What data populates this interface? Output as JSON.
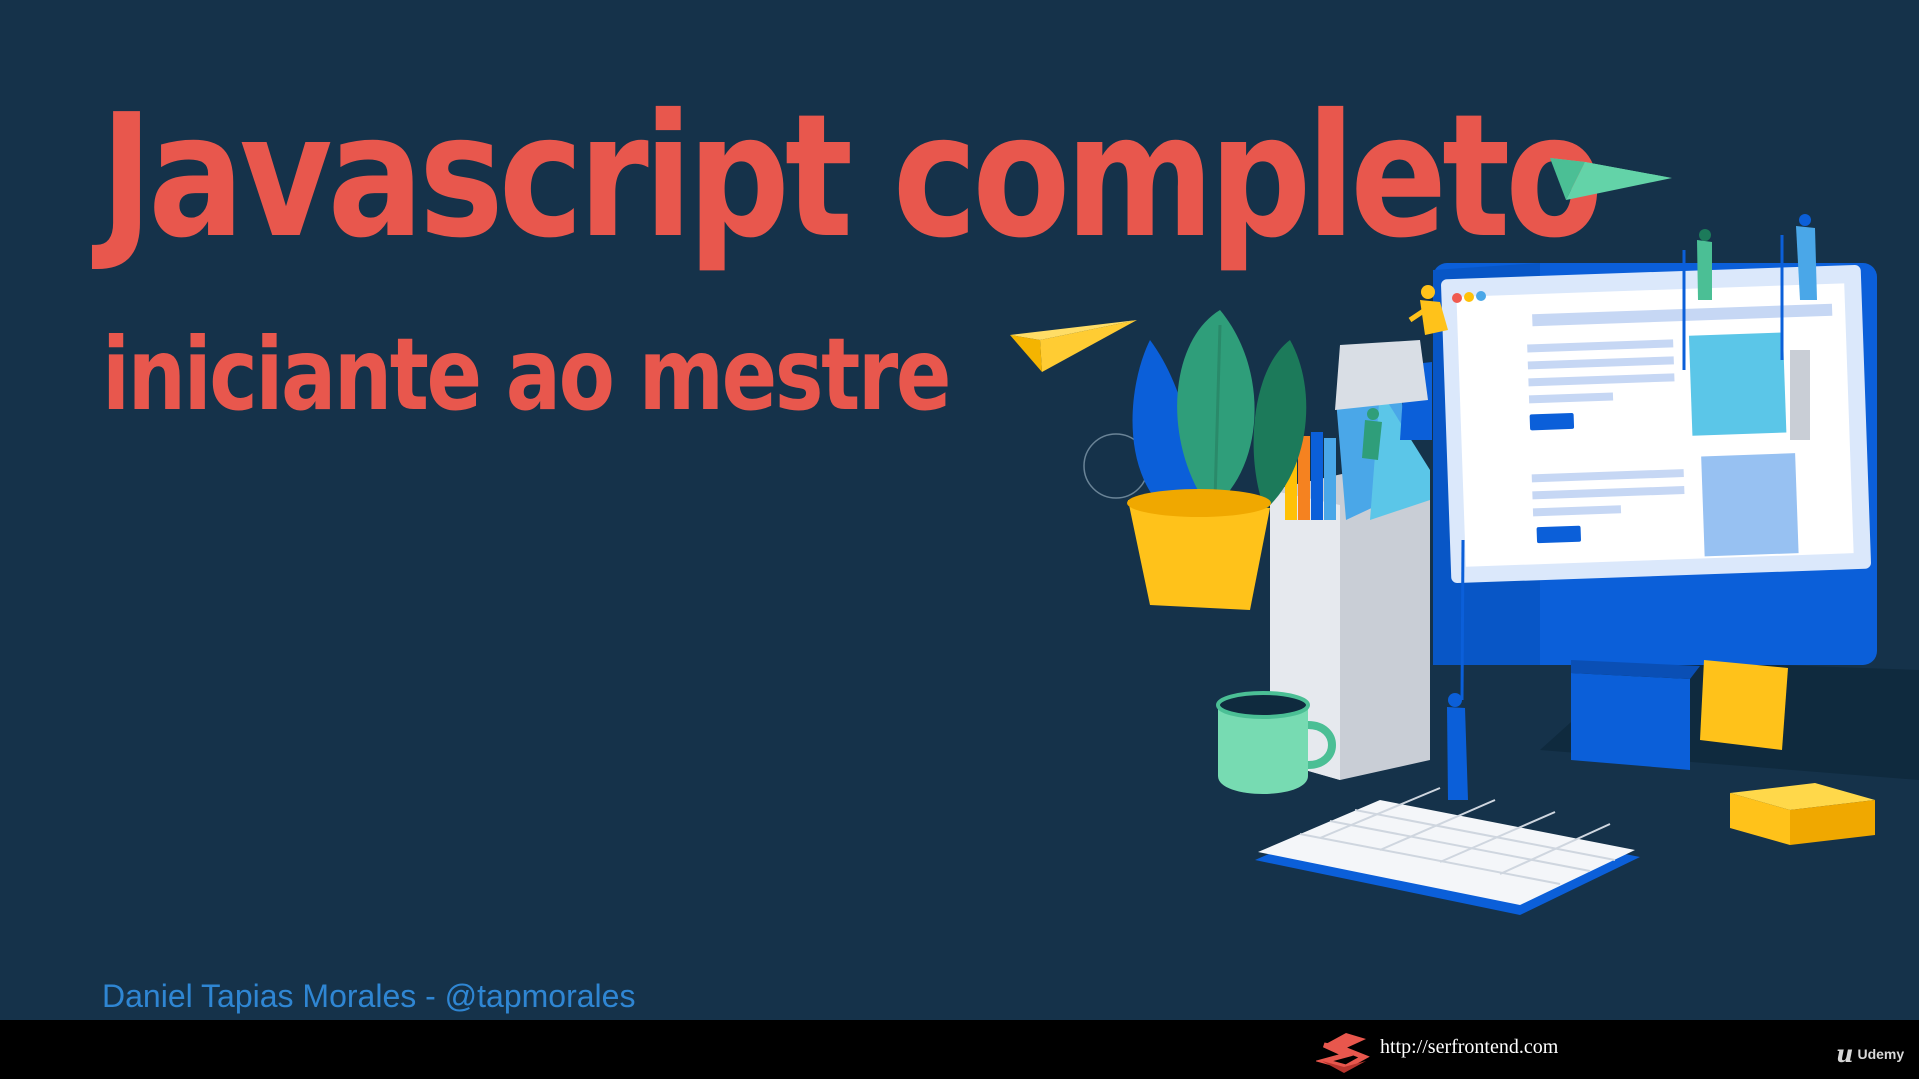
{
  "slide": {
    "title": "Javascript completo",
    "subtitle": "iniciante ao mestre",
    "author": "Daniel Tapias Morales - @tapmorales"
  },
  "footer": {
    "url": "http://serfrontend.com",
    "platform": "Udemy",
    "platform_icon": "udemy-logo-icon",
    "site_icon": "serfrontend-logo-icon"
  },
  "colors": {
    "background": "#15324a",
    "title": "#e8574d",
    "author": "#2f86d3",
    "footer": "#000000"
  },
  "illustration": {
    "icon": "web-development-workspace-illustration"
  }
}
